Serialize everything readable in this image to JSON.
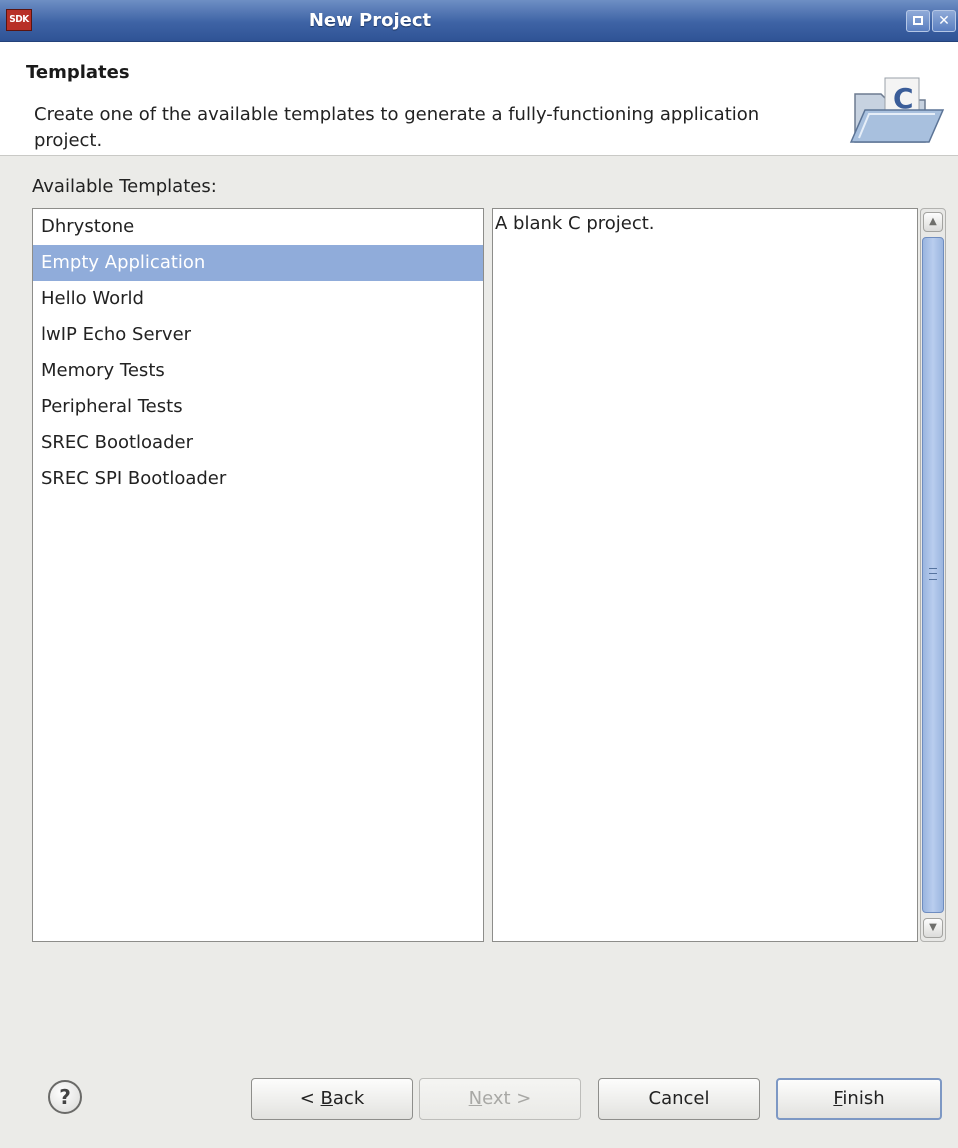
{
  "window": {
    "app_icon_text": "SDK",
    "title": "New Project"
  },
  "header": {
    "title": "Templates",
    "description": "Create one of the available templates to generate a fully-functioning application project.",
    "icon": "new-c-project-folder-icon"
  },
  "templates": {
    "label": "Available Templates:",
    "items": [
      {
        "label": "Dhrystone",
        "selected": false
      },
      {
        "label": "Empty Application",
        "selected": true
      },
      {
        "label": "Hello World",
        "selected": false
      },
      {
        "label": "lwIP Echo Server",
        "selected": false
      },
      {
        "label": "Memory Tests",
        "selected": false
      },
      {
        "label": "Peripheral Tests",
        "selected": false
      },
      {
        "label": "SREC Bootloader",
        "selected": false
      },
      {
        "label": "SREC SPI Bootloader",
        "selected": false
      }
    ],
    "description": "A blank C project."
  },
  "footer": {
    "help_glyph": "?",
    "back": {
      "pre": "< ",
      "mnemonic": "B",
      "post": "ack"
    },
    "next": {
      "pre": "",
      "mnemonic": "N",
      "post": "ext >"
    },
    "cancel": "Cancel",
    "finish": {
      "pre": "",
      "mnemonic": "F",
      "post": "inish"
    }
  },
  "colors": {
    "titlebar": "#3e63a5",
    "selection": "#90acda",
    "window_bg": "#ebebe8"
  }
}
